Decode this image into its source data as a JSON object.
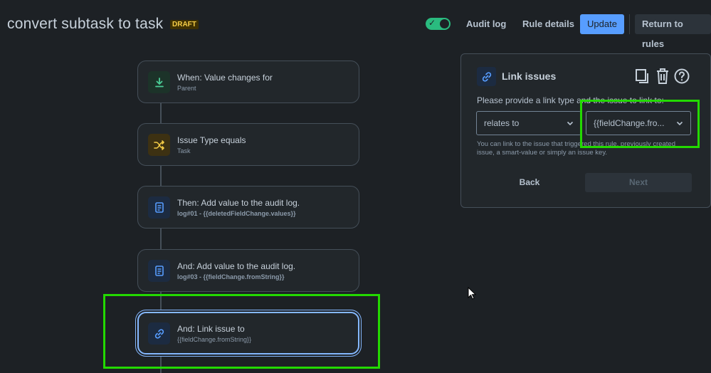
{
  "header": {
    "title": "convert subtask to task",
    "status_badge": "DRAFT",
    "enabled_toggle": true,
    "audit_log_label": "Audit log",
    "rule_details_label": "Rule details",
    "update_label": "Update",
    "return_label": "Return to rules"
  },
  "flow": {
    "steps": [
      {
        "label": "When: Value changes for",
        "detail": "Parent",
        "icon": "trigger-icon"
      },
      {
        "label": "Issue Type equals",
        "detail": "Task",
        "icon": "condition-icon"
      },
      {
        "label": "Then: Add value to the audit log.",
        "detail": "log#01 - {{deletedFieldChange.values}}",
        "icon": "audit-log-icon"
      },
      {
        "label": "And: Add value to the audit log.",
        "detail": "log#03 - {{fieldChange.fromString}}",
        "icon": "audit-log-icon"
      },
      {
        "label": "And: Link issue to",
        "detail": "{{fieldChange.fromString}}",
        "icon": "link-icon"
      }
    ]
  },
  "panel": {
    "title": "Link issues",
    "prompt": "Please provide a link type and the issue to link to:",
    "link_type_value": "relates to",
    "issue_value": "{{fieldChange.fro...",
    "help_text": "You can link to the issue that triggered this rule, previously created issue, a smart-value or simply an issue key.",
    "back_label": "Back",
    "next_label": "Next"
  },
  "colors": {
    "background": "#1d2125",
    "accent": "#579dff",
    "highlight": "#23d900",
    "toggle_on": "#2abb7f"
  }
}
